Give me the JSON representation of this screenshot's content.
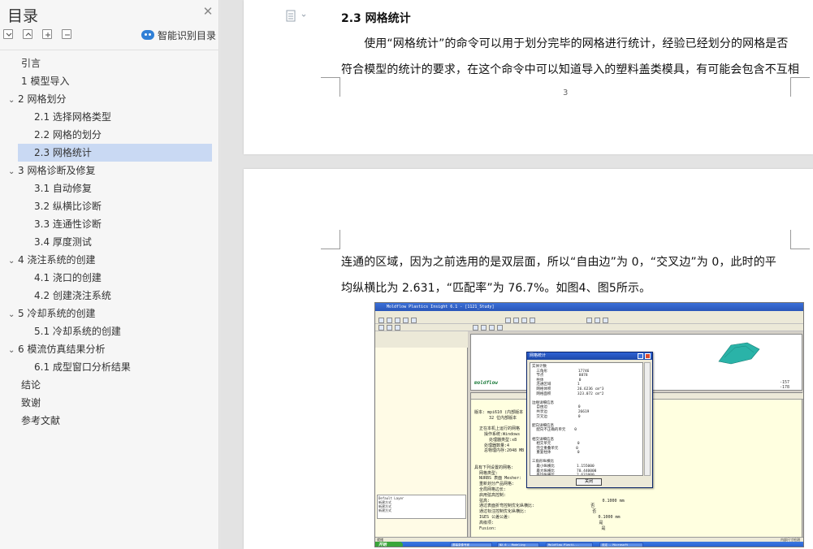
{
  "sidebar": {
    "title": "目录",
    "smart_toc_label": "智能识别目录",
    "items": [
      {
        "label": "引言",
        "level": 1,
        "expandable": false,
        "expanded": false,
        "active": false
      },
      {
        "label": "1 模型导入",
        "level": 1,
        "expandable": false,
        "expanded": false,
        "active": false
      },
      {
        "label": "2 网格划分",
        "level": 1,
        "expandable": true,
        "expanded": true,
        "active": false
      },
      {
        "label": "2.1  选择网格类型",
        "level": 2,
        "expandable": false,
        "expanded": false,
        "active": false
      },
      {
        "label": "2.2 网格的划分",
        "level": 2,
        "expandable": false,
        "expanded": false,
        "active": false
      },
      {
        "label": "2.3 网格统计",
        "level": 2,
        "expandable": false,
        "expanded": false,
        "active": true
      },
      {
        "label": "3 网格诊断及修复",
        "level": 1,
        "expandable": true,
        "expanded": true,
        "active": false
      },
      {
        "label": "3.1 自动修复",
        "level": 2,
        "expandable": false,
        "expanded": false,
        "active": false
      },
      {
        "label": "3.2 纵横比诊断",
        "level": 2,
        "expandable": false,
        "expanded": false,
        "active": false
      },
      {
        "label": "3.3 连通性诊断",
        "level": 2,
        "expandable": false,
        "expanded": false,
        "active": false
      },
      {
        "label": "3.4 厚度测试",
        "level": 2,
        "expandable": false,
        "expanded": false,
        "active": false
      },
      {
        "label": "4 浇注系统的创建",
        "level": 1,
        "expandable": true,
        "expanded": true,
        "active": false
      },
      {
        "label": "4.1 浇口的创建",
        "level": 2,
        "expandable": false,
        "expanded": false,
        "active": false
      },
      {
        "label": "4.2 创建浇注系统",
        "level": 2,
        "expandable": false,
        "expanded": false,
        "active": false
      },
      {
        "label": "5 冷却系统的创建",
        "level": 1,
        "expandable": true,
        "expanded": true,
        "active": false
      },
      {
        "label": "5.1 冷却系统的创建",
        "level": 2,
        "expandable": false,
        "expanded": false,
        "active": false
      },
      {
        "label": "6 模流仿真结果分析",
        "level": 1,
        "expandable": true,
        "expanded": true,
        "active": false
      },
      {
        "label": "6.1 成型窗口分析结果",
        "level": 2,
        "expandable": false,
        "expanded": false,
        "active": false
      },
      {
        "label": "结论",
        "level": 1,
        "expandable": false,
        "expanded": false,
        "active": false
      },
      {
        "label": "致谢",
        "level": 1,
        "expandable": false,
        "expanded": false,
        "active": false
      },
      {
        "label": "参考文献",
        "level": 1,
        "expandable": false,
        "expanded": false,
        "active": false
      }
    ]
  },
  "page1": {
    "heading": "2.3 网格统计",
    "line1": "　　使用“网格统计”的命令可以用于划分完毕的网格进行统计，经验已经划分的网格是否",
    "line2": "符合模型的统计的要求，在这个命令中可以知道导入的塑料盖类模具，有可能会包含不互相",
    "page_number": "3"
  },
  "page2": {
    "line1": "连通的区域，因为之前选用的是双层面，所以“自由边”为 0，“交叉边”为 0，此时的平",
    "line2": "均纵横比为 2.631，“匹配率”为 76.7%。如图4、图5所示。"
  },
  "figure": {
    "window_title": "Moldflow Plastics Insight 6.1 - [1121_Study]",
    "logo": "moldflow",
    "scale_top": "-157",
    "scale_bottom": "-178",
    "dialog_title": "网格统计",
    "dialog_body": "实体计数\n  三角形              17746\n  节点                8878\n  柱体                0\n  连通区域            1\n  网格体积            26.6236 cm^3\n  网格面积            323.072 cm^2\n\n边缘详细信息\n  自由边              0\n  共享边              26619\n  交叉边              0\n\n配向详细信息\n  配向不正确的单元    0\n\n相交详细信息\n  相交单元            0\n  完全重叠单元        0\n  重复柱体            0\n\n三角形纵横比\n  最小纵横比          1.155000\n  最大纵横比          70.440000\n  平均纵横比          2.631000",
    "dialog_ok": "关闭",
    "log_text": "\n版本: mpi610 (内部版本\n      32 位内部版本\n\n  正在本机上运行的网格\n    操作系统:Windows\n      处理器类型:x8\n    处理器数量:4\n    总物理内存:2048 MB\n\n\n具有下列设置的网格:\n  网格类型:\n  NURBS 表面 Mesher:\n  重新划分产品网格:\n  全局网格边长:\n  启用弦高控制:\n  弦高:                                              0.1000 mm\n  通过表面折弯控制优化纵横比:                       否\n  通过标注控制优化纵横比:                           否\n  IGES 公差公差:                                    0.1000 mm\n  高级项:                                           是\n  Fusion:                                           是",
    "study_tree": "Default Layer\n新建方式\n新建方式\n新建方式",
    "status_left": "就绪",
    "status_right": "内部尺寸检测",
    "start_label": "开始",
    "taskbar": [
      "屏幕录像专家",
      "NX 6 - Modeling",
      "Moldflow Plasti...",
      "设定 - Microsoft"
    ]
  }
}
